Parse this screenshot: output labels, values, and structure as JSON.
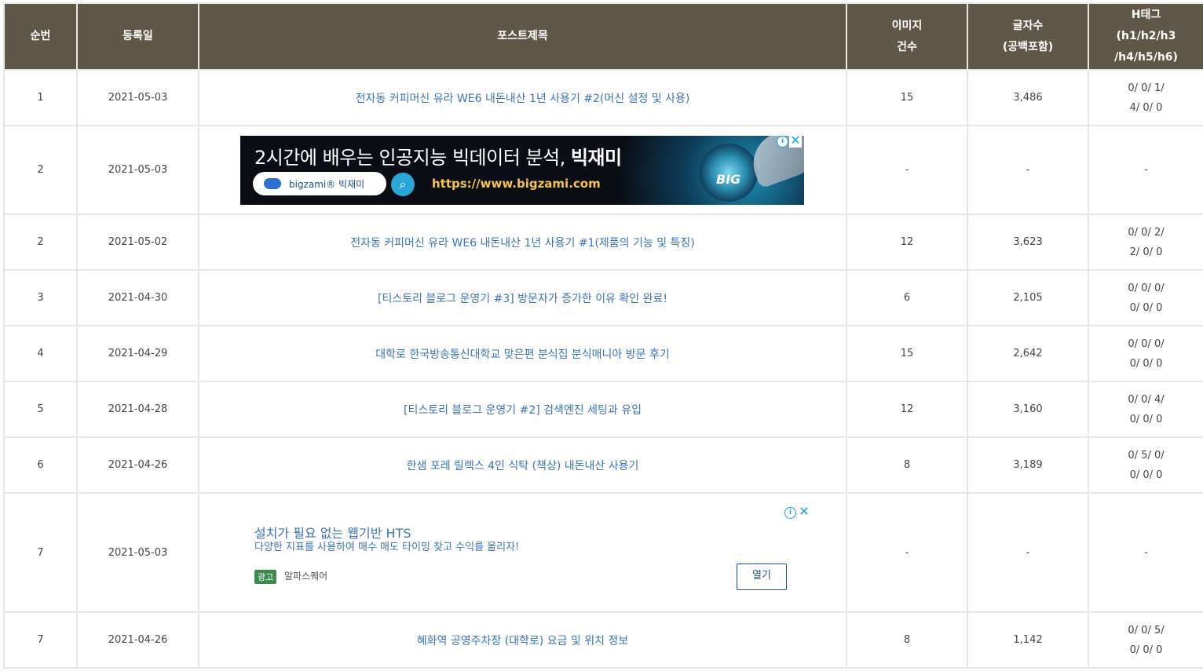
{
  "header": {
    "no": "순번",
    "date": "등록일",
    "title": "포스트제목",
    "images": [
      "이미지",
      "건수"
    ],
    "chars": [
      "글자수",
      "(공백포함)"
    ],
    "htag": [
      "H태그",
      "(h1/h2/h3",
      "/h4/h5/h6)"
    ]
  },
  "rows": [
    {
      "no": "1",
      "date": "2021-05-03",
      "title": "전자동 커피머신 유라 WE6 내돈내산 1년 사용기 #2(머신 설정 및 사용)",
      "images": "15",
      "chars": "3,486",
      "h1": "0/ 0/ 1/",
      "h2": "4/ 0/ 0"
    },
    {
      "no": "2",
      "date": "2021-05-03",
      "ad": "banner",
      "images": "-",
      "chars": "-",
      "h1": "-"
    },
    {
      "no": "2",
      "date": "2021-05-02",
      "title": "전자동 커피머신 유라 WE6 내돈내산 1년 사용기 #1(제품의 기능 및 특징)",
      "images": "12",
      "chars": "3,623",
      "h1": "0/ 0/ 2/",
      "h2": "2/ 0/ 0"
    },
    {
      "no": "3",
      "date": "2021-04-30",
      "title": "[티스토리 블로그 운영기 #3] 방문자가 증가한 이유 확인 완료!",
      "images": "6",
      "chars": "2,105",
      "h1": "0/ 0/ 0/",
      "h2": "0/ 0/ 0"
    },
    {
      "no": "4",
      "date": "2021-04-29",
      "title": "대학로 한국방송통신대학교 맞은편 분식집 분식매니아 방문 후기",
      "images": "15",
      "chars": "2,642",
      "h1": "0/ 0/ 0/",
      "h2": "0/ 0/ 0"
    },
    {
      "no": "5",
      "date": "2021-04-28",
      "title": "[티스토리 블로그 운영기 #2] 검색엔진 세팅과 유입",
      "images": "12",
      "chars": "3,160",
      "h1": "0/ 0/ 4/",
      "h2": "0/ 0/ 0"
    },
    {
      "no": "6",
      "date": "2021-04-26",
      "title": "한샘 포레 릴렉스 4인 식탁 (책상) 내돈내산 사용기",
      "images": "8",
      "chars": "3,189",
      "h1": "0/ 5/ 0/",
      "h2": "0/ 0/ 0"
    },
    {
      "no": "7",
      "date": "2021-05-03",
      "ad": "text",
      "images": "-",
      "chars": "-",
      "h1": "-"
    },
    {
      "no": "7",
      "date": "2021-04-26",
      "title": "혜화역 공영주차장 (대학로) 요금 및 위치 정보",
      "images": "8",
      "chars": "1,142",
      "h1": "0/ 0/ 5/",
      "h2": "0/ 0/ 0"
    }
  ],
  "ad_banner": {
    "headline_pre": "2시간에 배우는 인공지능 빅데이터 분석, ",
    "headline_bold": "빅재미",
    "pill_brand": "bigzami® 빅재미",
    "search_glyph": "⌕",
    "url": "https://www.bigzami.com",
    "logo_mark": "BIG",
    "info_glyph": "i",
    "close_glyph": "✕"
  },
  "ad_text": {
    "title": "설치가 필요 없는 웹기반 HTS",
    "desc": "다양한 지표를 사용하여 매수 매도 타이밍 찾고 수익를 올리자!",
    "badge": "광고",
    "advertiser": "알파스퀘어",
    "open_label": "열기",
    "info_glyph": "i",
    "close_glyph": "✕"
  },
  "colors": {
    "header_bg": "#5f5849",
    "link": "#3b73b9",
    "ad_accent": "#1aa1d9",
    "badge": "#3e8a4c"
  }
}
